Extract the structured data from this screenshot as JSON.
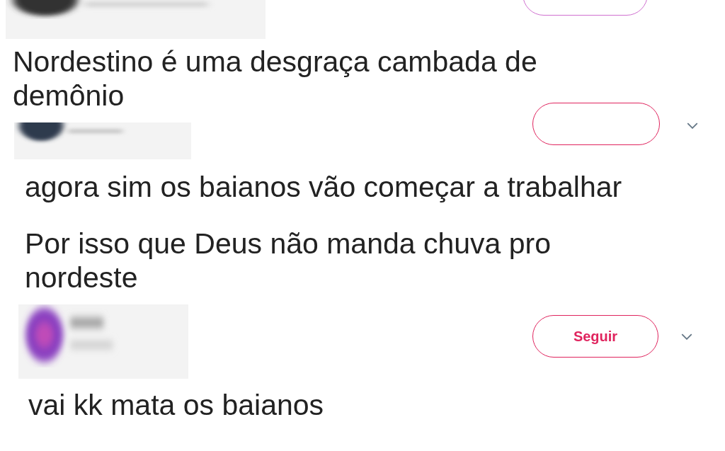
{
  "segments": [
    {
      "kind": "edge"
    },
    {
      "kind": "text",
      "text": "Nordestino é uma desgraça cambada de demônio"
    },
    {
      "kind": "header"
    },
    {
      "kind": "text",
      "text": "agora sim os baianos vão começar a trabalhar"
    },
    {
      "kind": "text",
      "text": "Por isso que Deus não manda chuva pro nordeste"
    },
    {
      "kind": "profile",
      "button_label": "Seguir"
    },
    {
      "kind": "text",
      "text": "vai kk mata os baianos"
    }
  ]
}
